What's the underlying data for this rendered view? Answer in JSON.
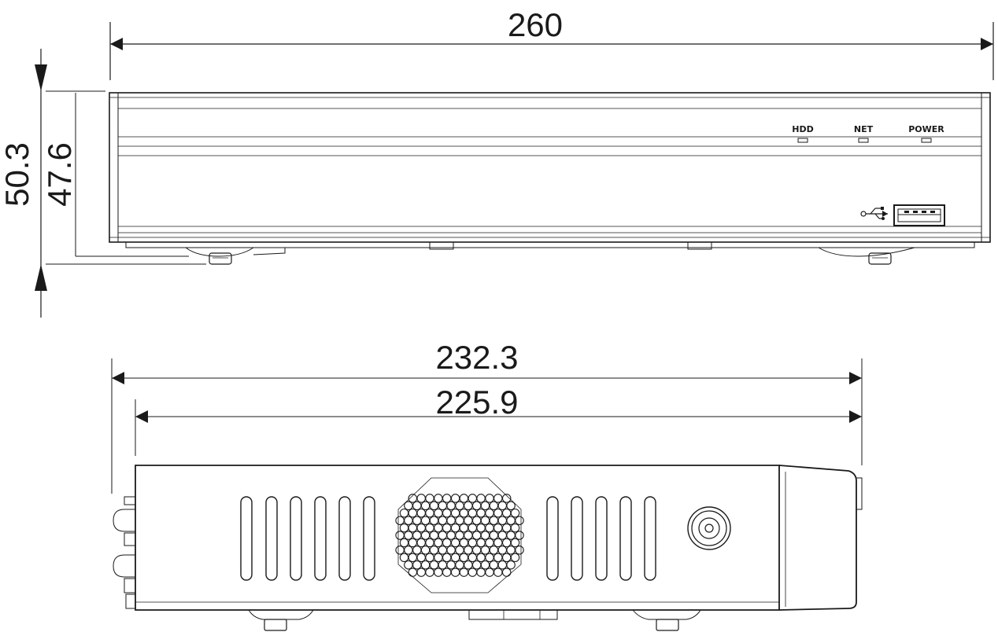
{
  "front_view": {
    "width_label": "260",
    "outer_height_label": "50.3",
    "body_height_label": "47.6",
    "indicators": [
      {
        "label": "HDD"
      },
      {
        "label": "NET"
      },
      {
        "label": "POWER"
      }
    ],
    "usb_icon": "usb-icon"
  },
  "side_view": {
    "overall_depth_label": "232.3",
    "body_depth_label": "225.9",
    "fan_icon": "fan-grille-icon"
  }
}
